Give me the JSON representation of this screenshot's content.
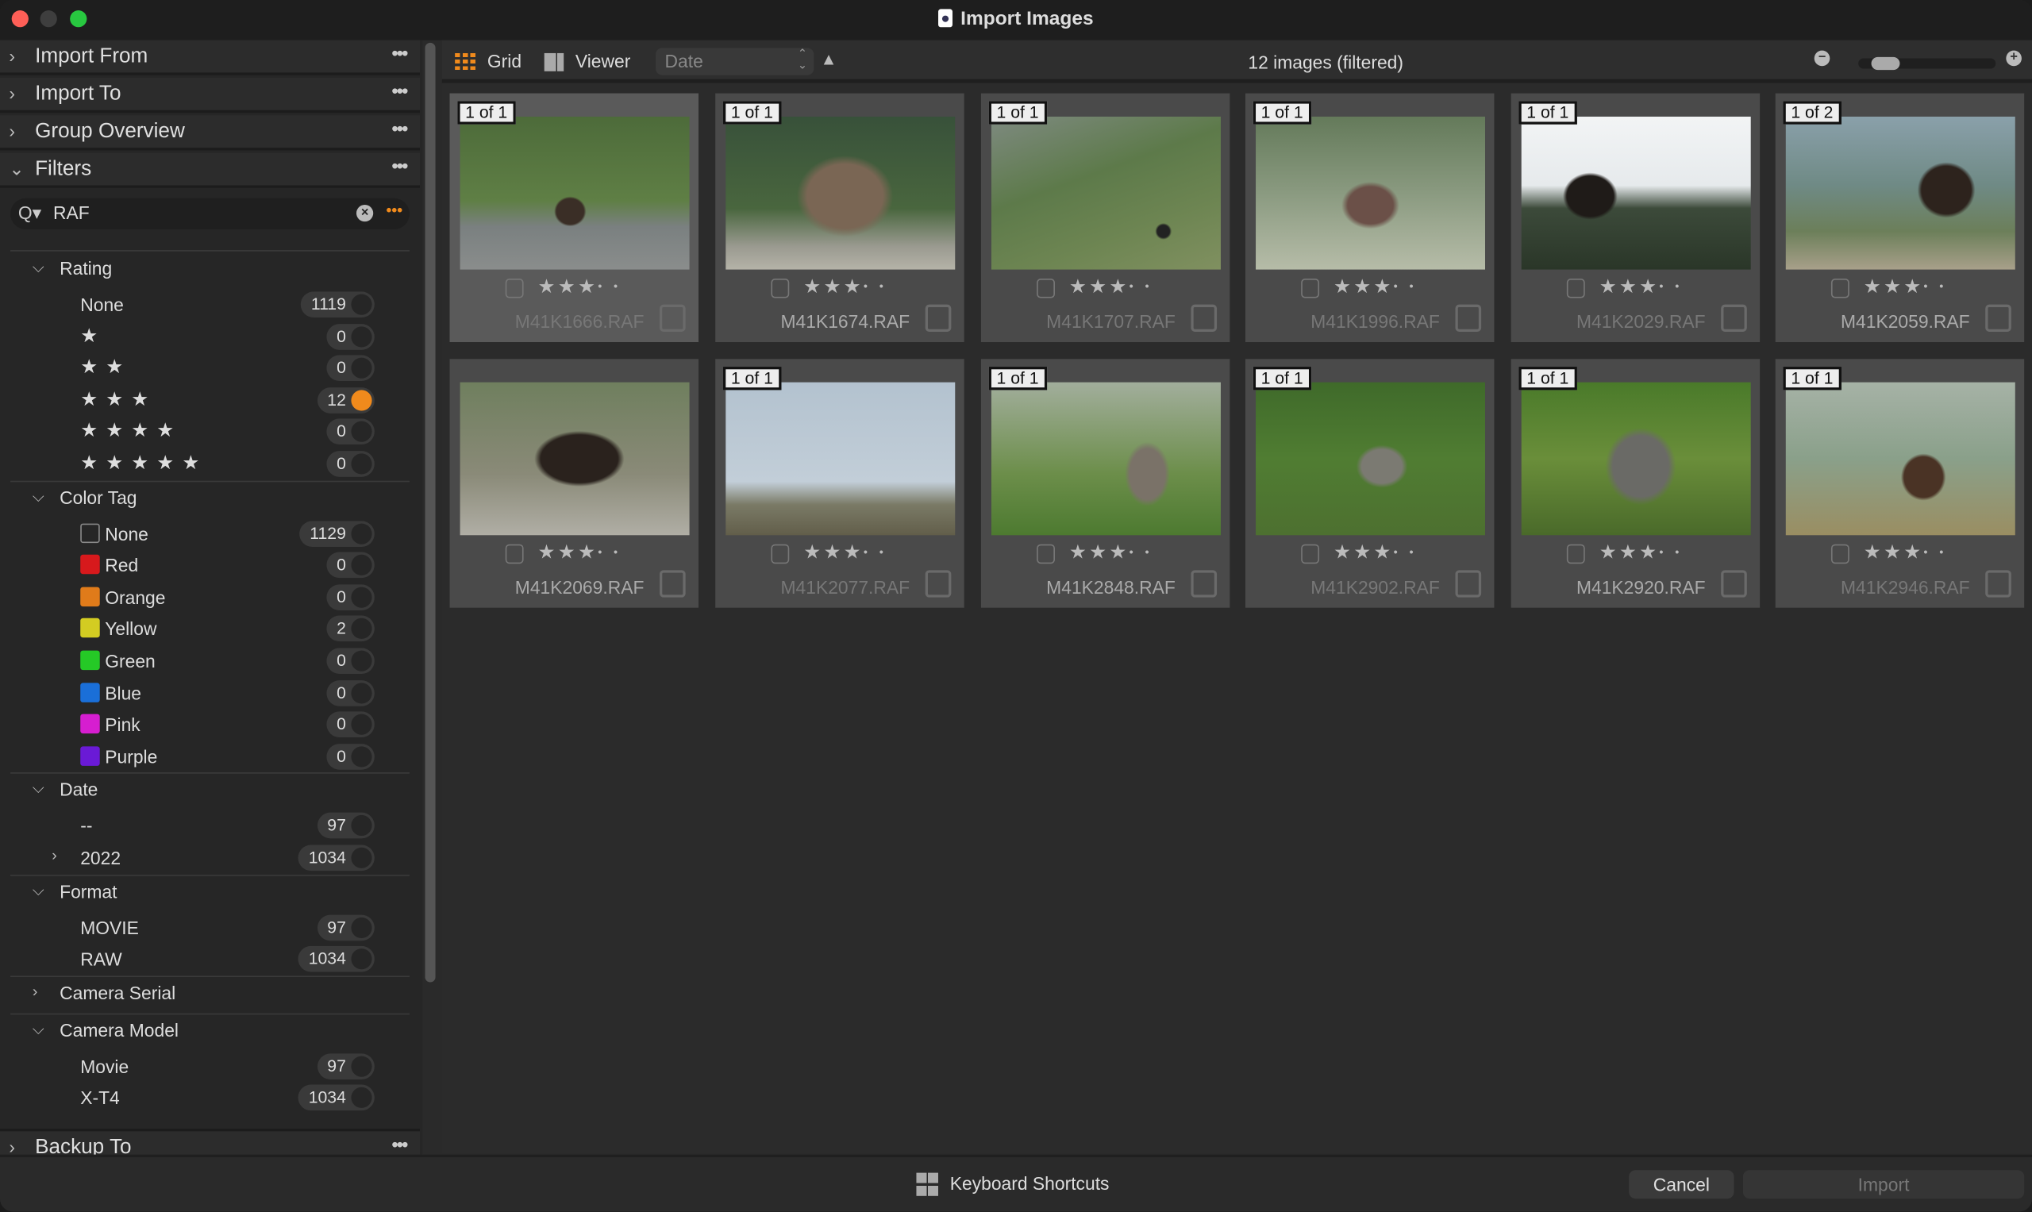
{
  "window": {
    "title": "Import Images"
  },
  "sidebar": {
    "panels": [
      {
        "label": "Import From",
        "expanded": false
      },
      {
        "label": "Import To",
        "expanded": false
      },
      {
        "label": "Group Overview",
        "expanded": false
      },
      {
        "label": "Filters",
        "expanded": true
      }
    ],
    "search": {
      "value": "RAF"
    },
    "filter_groups": [
      {
        "label": "Rating",
        "expanded": true,
        "items": [
          {
            "label": "None",
            "count": "1119"
          },
          {
            "stars": "★",
            "count": "0"
          },
          {
            "stars": "★ ★",
            "count": "0"
          },
          {
            "stars": "★ ★ ★",
            "count": "12",
            "active": true
          },
          {
            "stars": "★ ★ ★ ★",
            "count": "0"
          },
          {
            "stars": "★ ★ ★ ★ ★",
            "count": "0"
          }
        ]
      },
      {
        "label": "Color Tag",
        "expanded": true,
        "items": [
          {
            "label": "None",
            "swatch": "none",
            "count": "1129"
          },
          {
            "label": "Red",
            "swatch": "#d7191c",
            "count": "0"
          },
          {
            "label": "Orange",
            "swatch": "#e07b1a",
            "count": "0"
          },
          {
            "label": "Yellow",
            "swatch": "#d3cc22",
            "count": "2"
          },
          {
            "label": "Green",
            "swatch": "#25c926",
            "count": "0"
          },
          {
            "label": "Blue",
            "swatch": "#1a6fd8",
            "count": "0"
          },
          {
            "label": "Pink",
            "swatch": "#d61ed0",
            "count": "0"
          },
          {
            "label": "Purple",
            "swatch": "#6a1ad6",
            "count": "0"
          }
        ]
      },
      {
        "label": "Date",
        "expanded": true,
        "items": [
          {
            "label": "--",
            "count": "97"
          },
          {
            "label": "2022",
            "count": "1034",
            "collapsible": true
          }
        ]
      },
      {
        "label": "Format",
        "expanded": true,
        "items": [
          {
            "label": "MOVIE",
            "count": "97"
          },
          {
            "label": "RAW",
            "count": "1034"
          }
        ]
      },
      {
        "label": "Camera Serial",
        "expanded": false,
        "items": []
      },
      {
        "label": "Camera Model",
        "expanded": true,
        "items": [
          {
            "label": "Movie",
            "count": "97"
          },
          {
            "label": "X-T4",
            "count": "1034"
          }
        ]
      }
    ],
    "backup_panel": {
      "label": "Backup To"
    }
  },
  "toolbar": {
    "grid_label": "Grid",
    "viewer_label": "Viewer",
    "sort_field": "Date",
    "sort_direction": "ascending",
    "image_count": "12 images (filtered)",
    "thumbnail_size_percent": 12
  },
  "accent_color": "#f08a1c",
  "images": [
    {
      "filename": "M41K1666.RAF",
      "badge": "1 of 1",
      "rating": 3,
      "selected": true,
      "scene": "muskox-distant-green"
    },
    {
      "filename": "M41K1674.RAF",
      "badge": "1 of 1",
      "rating": 3,
      "bright": true,
      "scene": "muskox-closeup"
    },
    {
      "filename": "M41K1707.RAF",
      "badge": "1 of 1",
      "rating": 3,
      "scene": "hillside"
    },
    {
      "filename": "M41K1996.RAF",
      "badge": "1 of 1",
      "rating": 3,
      "scene": "muskox-meadow"
    },
    {
      "filename": "M41K2029.RAF",
      "badge": "1 of 1",
      "rating": 3,
      "scene": "muskox-sky"
    },
    {
      "filename": "M41K2059.RAF",
      "badge": "1 of 2",
      "rating": 3,
      "bright": true,
      "scene": "muskox-valley"
    },
    {
      "filename": "M41K2069.RAF",
      "badge": "",
      "rating": 3,
      "bright": true,
      "scene": "muskox-rocks"
    },
    {
      "filename": "M41K2077.RAF",
      "badge": "1 of 1",
      "rating": 3,
      "scene": "sky-ridge"
    },
    {
      "filename": "M41K2848.RAF",
      "badge": "1 of 1",
      "rating": 3,
      "bright": true,
      "scene": "ptarmigan"
    },
    {
      "filename": "M41K2902.RAF",
      "badge": "1 of 1",
      "rating": 3,
      "scene": "ptarmigan-bush"
    },
    {
      "filename": "M41K2920.RAF",
      "badge": "1 of 1",
      "rating": 3,
      "bright": true,
      "scene": "ptarmigan-close"
    },
    {
      "filename": "M41K2946.RAF",
      "badge": "1 of 1",
      "rating": 3,
      "scene": "muskox-front"
    }
  ],
  "footer": {
    "shortcuts_label": "Keyboard Shortcuts",
    "cancel_label": "Cancel",
    "import_label": "Import"
  }
}
